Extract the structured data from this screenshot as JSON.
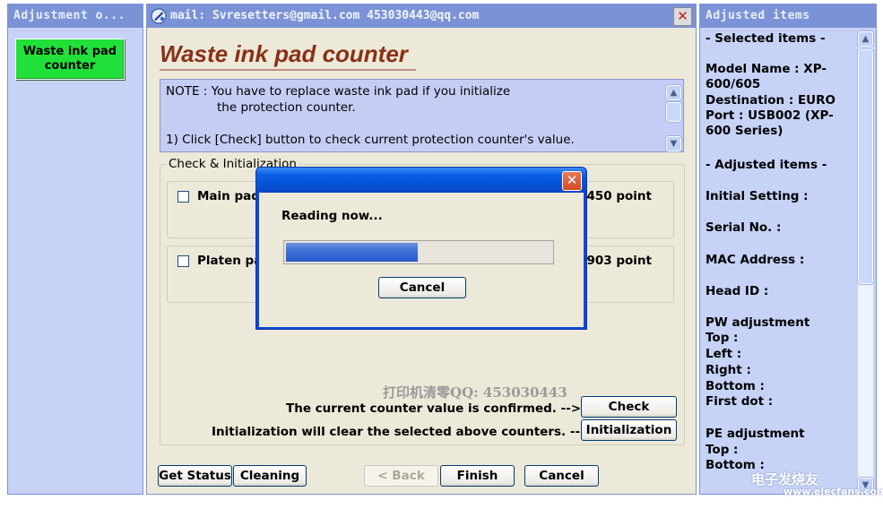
{
  "left_panel": {
    "title": "Adjustment o...",
    "nav_item_line1": "Waste ink pad",
    "nav_item_line2": "counter"
  },
  "main": {
    "window_title": "mail: Svresetters@gmail.com  453030443@qq.com",
    "page_title": "Waste ink pad counter",
    "note": {
      "line1": "NOTE : You have to replace waste ink pad if you initialize",
      "line2": "the protection counter.",
      "line3": "1) Click [Check] button to check current protection counter's value."
    },
    "group_label": "Check & Initialization",
    "pads": [
      {
        "label": "Main pad",
        "value": "450 point",
        "checked": false
      },
      {
        "label": "Platen pa",
        "value": "903 point",
        "checked": false
      }
    ],
    "watermark": "打印机清零QQ: 453030443",
    "confirm_text": "The current counter value is confirmed. -->",
    "init_text": "Initialization will clear the selected above counters. -->",
    "check_label": "Check",
    "initialization_label": "Initialization",
    "bottom_buttons": {
      "get_status": "Get Status",
      "cleaning": "Cleaning",
      "back": "< Back",
      "finish": "Finish",
      "cancel": "Cancel"
    }
  },
  "dialog": {
    "message": "Reading now...",
    "progress": 0.5,
    "cancel_label": "Cancel",
    "close_icon": "close-icon"
  },
  "right_panel": {
    "title": "Adjusted items",
    "lines": [
      "- Selected items -",
      "Model Name : XP-600/605",
      "Destination : EURO",
      "Port : USB002 (XP-600 Series)",
      "- Adjusted items -",
      "Initial Setting :",
      "Serial No. :",
      "MAC Address :",
      "Head ID :",
      "PW adjustment",
      "Top :",
      "Left :",
      "Right :",
      "Bottom :",
      "First dot :",
      "PE adjustment",
      "Top :",
      "Bottom :"
    ]
  },
  "logo_watermark": {
    "text": "电子发烧友",
    "url_text": "www.elecfans.com"
  },
  "colors": {
    "panel_bg": "#c6d3f7",
    "titlebar": "#7b93d6",
    "nav_active": "#22e03a",
    "window_bg": "#ece9d8",
    "title_text": "#8a3018",
    "progress": "#3a6fd8"
  }
}
